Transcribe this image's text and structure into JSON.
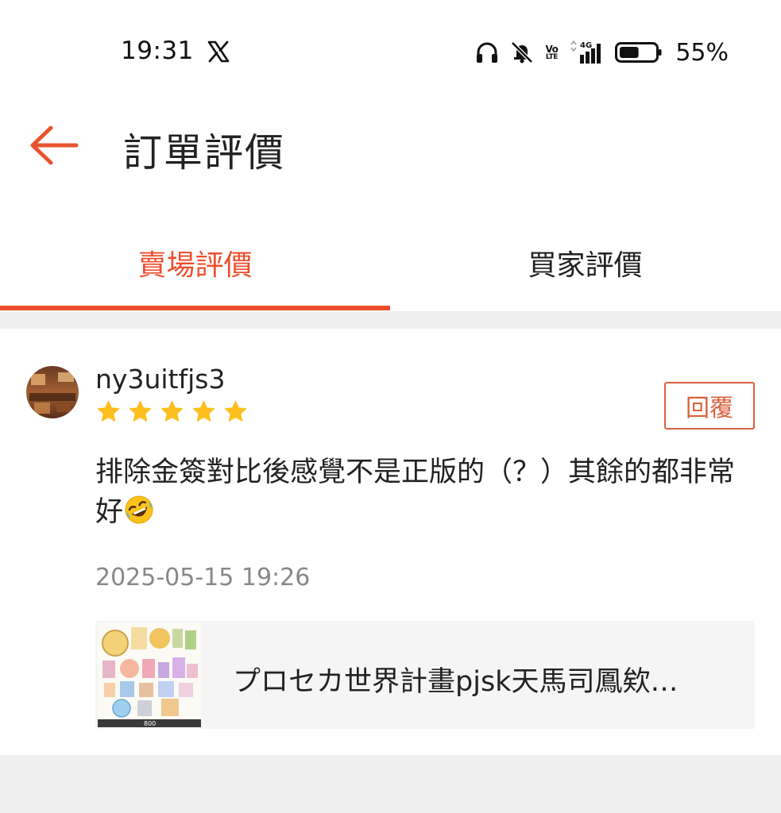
{
  "status_bar": {
    "time": "19:31",
    "app_icon": "x-logo-icon",
    "icons": [
      "headphones-icon",
      "bell-muted-icon",
      "volte-icon",
      "signal-4g-icon",
      "battery-icon"
    ],
    "volte_top": "Vo",
    "volte_bottom": "LTE",
    "network": "4G",
    "battery_percent": "55%",
    "battery_level": 0.55
  },
  "header": {
    "back_icon": "back-arrow-icon",
    "title": "訂單評價"
  },
  "tabs": [
    {
      "label": "賣場評價",
      "active": true
    },
    {
      "label": "買家評價",
      "active": false
    }
  ],
  "review": {
    "username": "ny3uitfjs3",
    "rating": 5,
    "reply_label": "回覆",
    "comment": "排除金簽對比後感覺不是正版的（？）其餘的都非常好",
    "comment_emoji": "🤣",
    "timestamp": "2025-05-15 19:26",
    "product": {
      "title": "プロセカ世界計畫pjsk天馬司鳳欸…",
      "thumb_caption": "800"
    }
  },
  "colors": {
    "accent": "#ee4d2d",
    "reply_border": "#d9613f",
    "star": "#fcbf1e",
    "separator": "#efefef",
    "product_bg": "#f5f5f5",
    "timestamp": "#888888"
  }
}
